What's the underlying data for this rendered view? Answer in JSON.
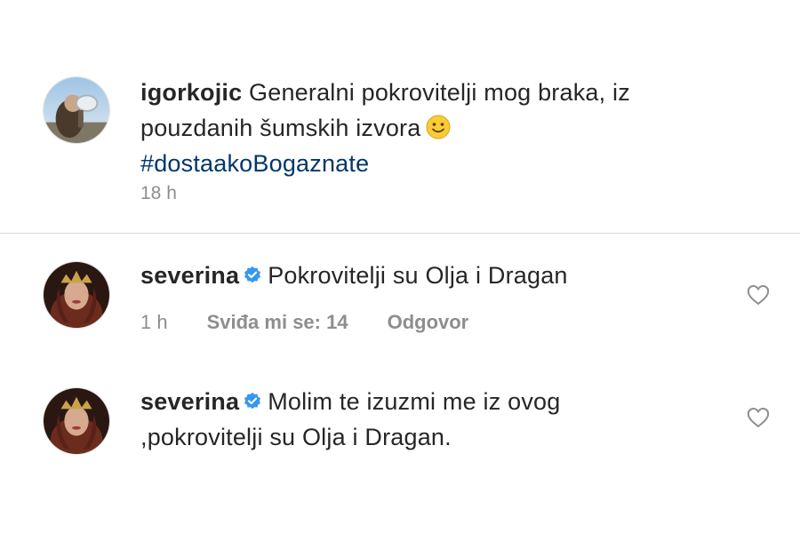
{
  "post": {
    "author": "igorkojic",
    "caption_text": "Generalni pokrovitelji mog braka, iz pouzdanih šumskih izvora",
    "hashtag": "#dostaakoBogaznate",
    "time": "18 h",
    "emoji": "slightly-smiling-face-emoji"
  },
  "comments": [
    {
      "author": "severina",
      "verified": true,
      "text": "Pokrovitelji su Olja i Dragan",
      "time": "1 h",
      "likes": "Sviđa mi se: 14",
      "reply": "Odgovor"
    },
    {
      "author": "severina",
      "verified": true,
      "text": "Molim te izuzmi me iz ovog ,pokrovitelji su Olja i Dragan."
    }
  ],
  "colors": {
    "text": "#262626",
    "secondary": "#8e8e8e",
    "hashtag": "#00376b",
    "verified": "#3897f0",
    "divider": "#dbdbdb"
  }
}
